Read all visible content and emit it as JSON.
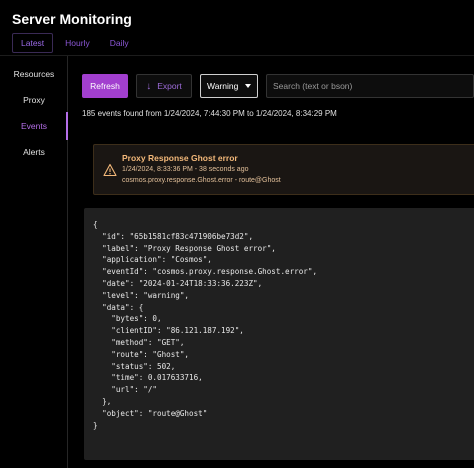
{
  "app": {
    "title": "Server Monitoring"
  },
  "tabs": [
    {
      "label": "Latest",
      "active": true
    },
    {
      "label": "Hourly",
      "active": false
    },
    {
      "label": "Daily",
      "active": false
    }
  ],
  "sidebar": {
    "items": [
      {
        "label": "Resources",
        "active": false
      },
      {
        "label": "Proxy",
        "active": false
      },
      {
        "label": "Events",
        "active": true
      },
      {
        "label": "Alerts",
        "active": false
      }
    ]
  },
  "toolbar": {
    "refresh_label": "Refresh",
    "export_label": "Export",
    "export_icon": "download-arrow-icon",
    "level_select_value": "Warning",
    "search_placeholder": "Search (text or bson)"
  },
  "summary": "185 events found from 1/24/2024, 7:44:30 PM to 1/24/2024, 8:34:29 PM",
  "event": {
    "title": "Proxy Response Ghost error",
    "time": "1/24/2024, 8:33:36 PM - 38 seconds ago",
    "source": "cosmos.proxy.response.Ghost.error - route@Ghost",
    "icon": "warning-triangle-icon",
    "json_lines": [
      "{",
      "  \"id\": \"65b1581cf83c471906be73d2\",",
      "  \"label\": \"Proxy Response Ghost error\",",
      "  \"application\": \"Cosmos\",",
      "  \"eventId\": \"cosmos.proxy.response.Ghost.error\",",
      "  \"date\": \"2024-01-24T18:33:36.223Z\",",
      "  \"level\": \"warning\",",
      "  \"data\": {",
      "    \"bytes\": 0,",
      "    \"clientID\": \"86.121.187.192\",",
      "    \"method\": \"GET\",",
      "    \"route\": \"Ghost\",",
      "    \"status\": 502,",
      "    \"time\": 0.017633716,",
      "    \"url\": \"/\"",
      "  },",
      "  \"object\": \"route@Ghost\"",
      "}"
    ]
  },
  "colors": {
    "accent": "#a23fcf",
    "tab_text": "#8b57d6",
    "active_nav": "#b46ee8",
    "warning_text": "#f4b97a",
    "warning_bg": "#1a1613",
    "json_bg": "#202020"
  }
}
